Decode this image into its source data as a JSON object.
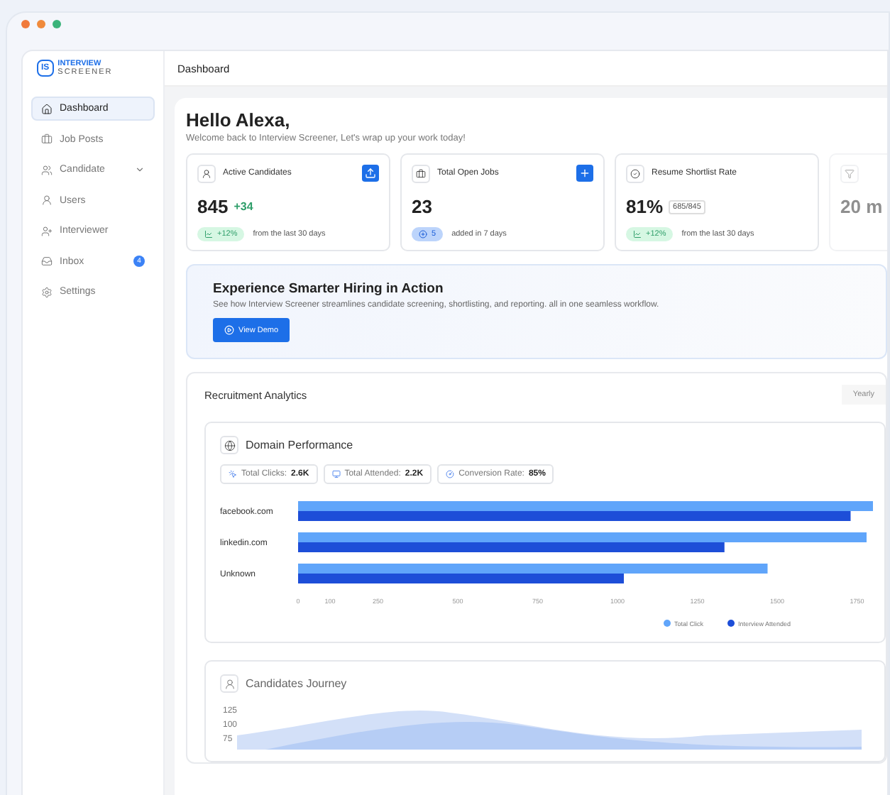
{
  "logo": {
    "line_1": "INTERVIEW",
    "line_2": "SCREENER",
    "badge": "IS"
  },
  "header": {
    "title": "Dashboard"
  },
  "sidebar": {
    "items": [
      {
        "label": "Dashboard",
        "selected": true,
        "expandable": false
      },
      {
        "label": "Job Posts",
        "selected": false,
        "expandable": false
      },
      {
        "label": "Candidate",
        "selected": false,
        "expandable": true
      },
      {
        "label": "Users",
        "selected": false,
        "expandable": false
      },
      {
        "label": "Interviewer",
        "selected": false,
        "expandable": false
      },
      {
        "label": "Inbox",
        "selected": false,
        "expandable": false,
        "badge": "4"
      },
      {
        "label": "Settings",
        "selected": false,
        "expandable": false
      }
    ]
  },
  "greeting": {
    "title": "Hello Alexa,",
    "subtitle": "Welcome back to Interview Screener, Let's wrap up your work today!"
  },
  "stat_cards": [
    {
      "title": "Active Candidates",
      "value": "845",
      "delta": "+34",
      "pill": "+12%",
      "note": "from the last 30 days",
      "faded": false
    },
    {
      "title": "Total Open Jobs",
      "value": "23",
      "pill": "5",
      "note": "added in 7 days",
      "faded": false
    },
    {
      "title": "Resume Shortlist Rate",
      "value": "81%",
      "ratio": "685/845",
      "pill": "+12%",
      "note": "from the last 30 days",
      "faded": false
    },
    {
      "value": "20 m",
      "faded": true
    }
  ],
  "banner": {
    "title": "Experience Smarter Hiring in Action",
    "text": "See how Interview Screener streamlines candidate screening, shortlisting, and reporting. all in one seamless workflow.",
    "button": "View Demo"
  },
  "analytics": {
    "title": "Recruitment Analytics",
    "period": "Yearly",
    "domain": {
      "title": "Domain Performance",
      "metrics": [
        {
          "label": "Total Clicks:",
          "value": "2.6K"
        },
        {
          "label": "Total Attended:",
          "value": "2.2K"
        },
        {
          "label": "Conversion Rate:",
          "value": "85%"
        }
      ],
      "chart_data": {
        "type": "bar",
        "orientation": "horizontal",
        "legend": "bottom-right",
        "categories": [
          "facebook.com",
          "linkedin.com",
          "Unknown"
        ],
        "xlim": [
          0,
          1800
        ],
        "xticks": [
          0,
          100,
          250,
          500,
          750,
          1000,
          1250,
          1500,
          1750
        ],
        "series": [
          {
            "name": "Total Click",
            "color": "#60a5fa",
            "values": [
              1800,
              1780,
              1470
            ]
          },
          {
            "name": "Interview Attended",
            "color": "#1d4ed8",
            "values": [
              1730,
              1335,
              1020
            ]
          }
        ]
      }
    },
    "journey": {
      "title": "Candidates Journey",
      "y_labels": [
        "125",
        "100",
        "75"
      ]
    }
  }
}
